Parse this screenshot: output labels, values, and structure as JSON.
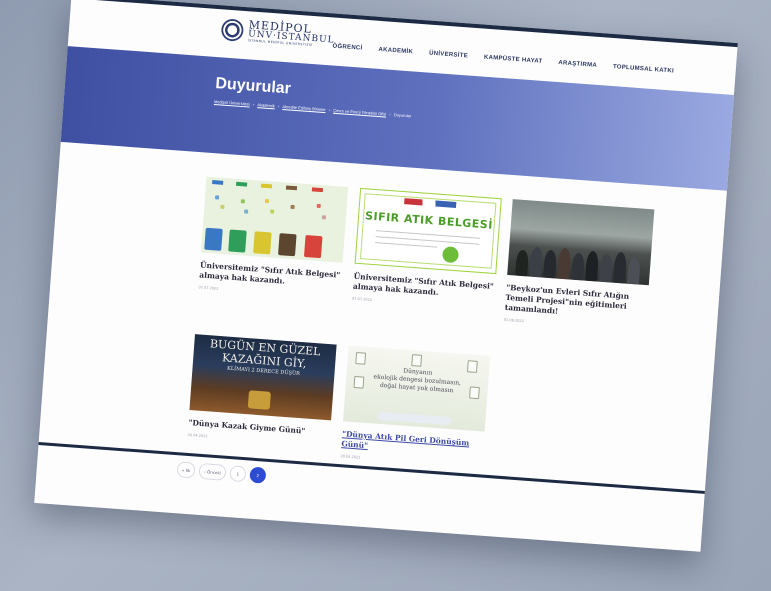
{
  "logo": {
    "line1": "MEDİPOL",
    "line2": "ÜNV·İSTANBUL",
    "line3": "İSTANBUL MEDİPOL ÜNİVERSİTESİ"
  },
  "nav": [
    "ÖĞRENCİ",
    "AKADEMİK",
    "ÜNİVERSİTE",
    "KAMPÜSTE HAYAT",
    "ARAŞTIRMA",
    "TOPLUMSAL KATKI"
  ],
  "hero": {
    "title": "Duyurular"
  },
  "breadcrumb": [
    "Medipol Üniversitesi",
    "Akademik",
    "Akredite Edilmiş Birimler",
    "Çevre ve Enerji Yönetimi Ofisi",
    "Duyurular"
  ],
  "cards": [
    {
      "title": "Üniversitemiz \"Sıfır Atık Belgesi\" almaya hak kazandı.",
      "date": "07.07.2022"
    },
    {
      "title": "Üniversitemiz \"Sıfır Atık Belgesi\" almaya hak kazandı.",
      "date": "07.07.2022"
    },
    {
      "title": "\"Beykoz'un Evleri Sıfır Atığın Temeli Projesi\"nin eğitimleri tamamlandı!",
      "date": "01.06.2022"
    },
    {
      "title": "\"Dünya Kazak Giyme Günü\"",
      "date": "20.04.2022"
    },
    {
      "title": "\"Dünya Atık Pil Geri Dönüşüm Günü\"",
      "date": "20.04.2022"
    }
  ],
  "card_images": {
    "certificate_heading": "SIFIR ATIK BELGESİ",
    "sweater_line1": "BUGÜN EN GÜZEL",
    "sweater_line2": "KAZAĞINI GİY,",
    "sweater_line3": "KLİMAYI 2 DERECE DÜŞÜR",
    "battery_line1": "Dünyanın",
    "battery_line2": "ekolojik dengesi bozulmasın,",
    "battery_line3": "doğal hayat yok olmasın"
  },
  "pagination": {
    "first": "« İlk",
    "prev": "‹ Önceki",
    "pages": [
      "1",
      "2"
    ],
    "current": "2"
  },
  "colors": {
    "accent": "#2d4bd3",
    "hero_start": "#3f4fa2",
    "hero_end": "#9aa9e0",
    "link": "#3c4aa5"
  }
}
